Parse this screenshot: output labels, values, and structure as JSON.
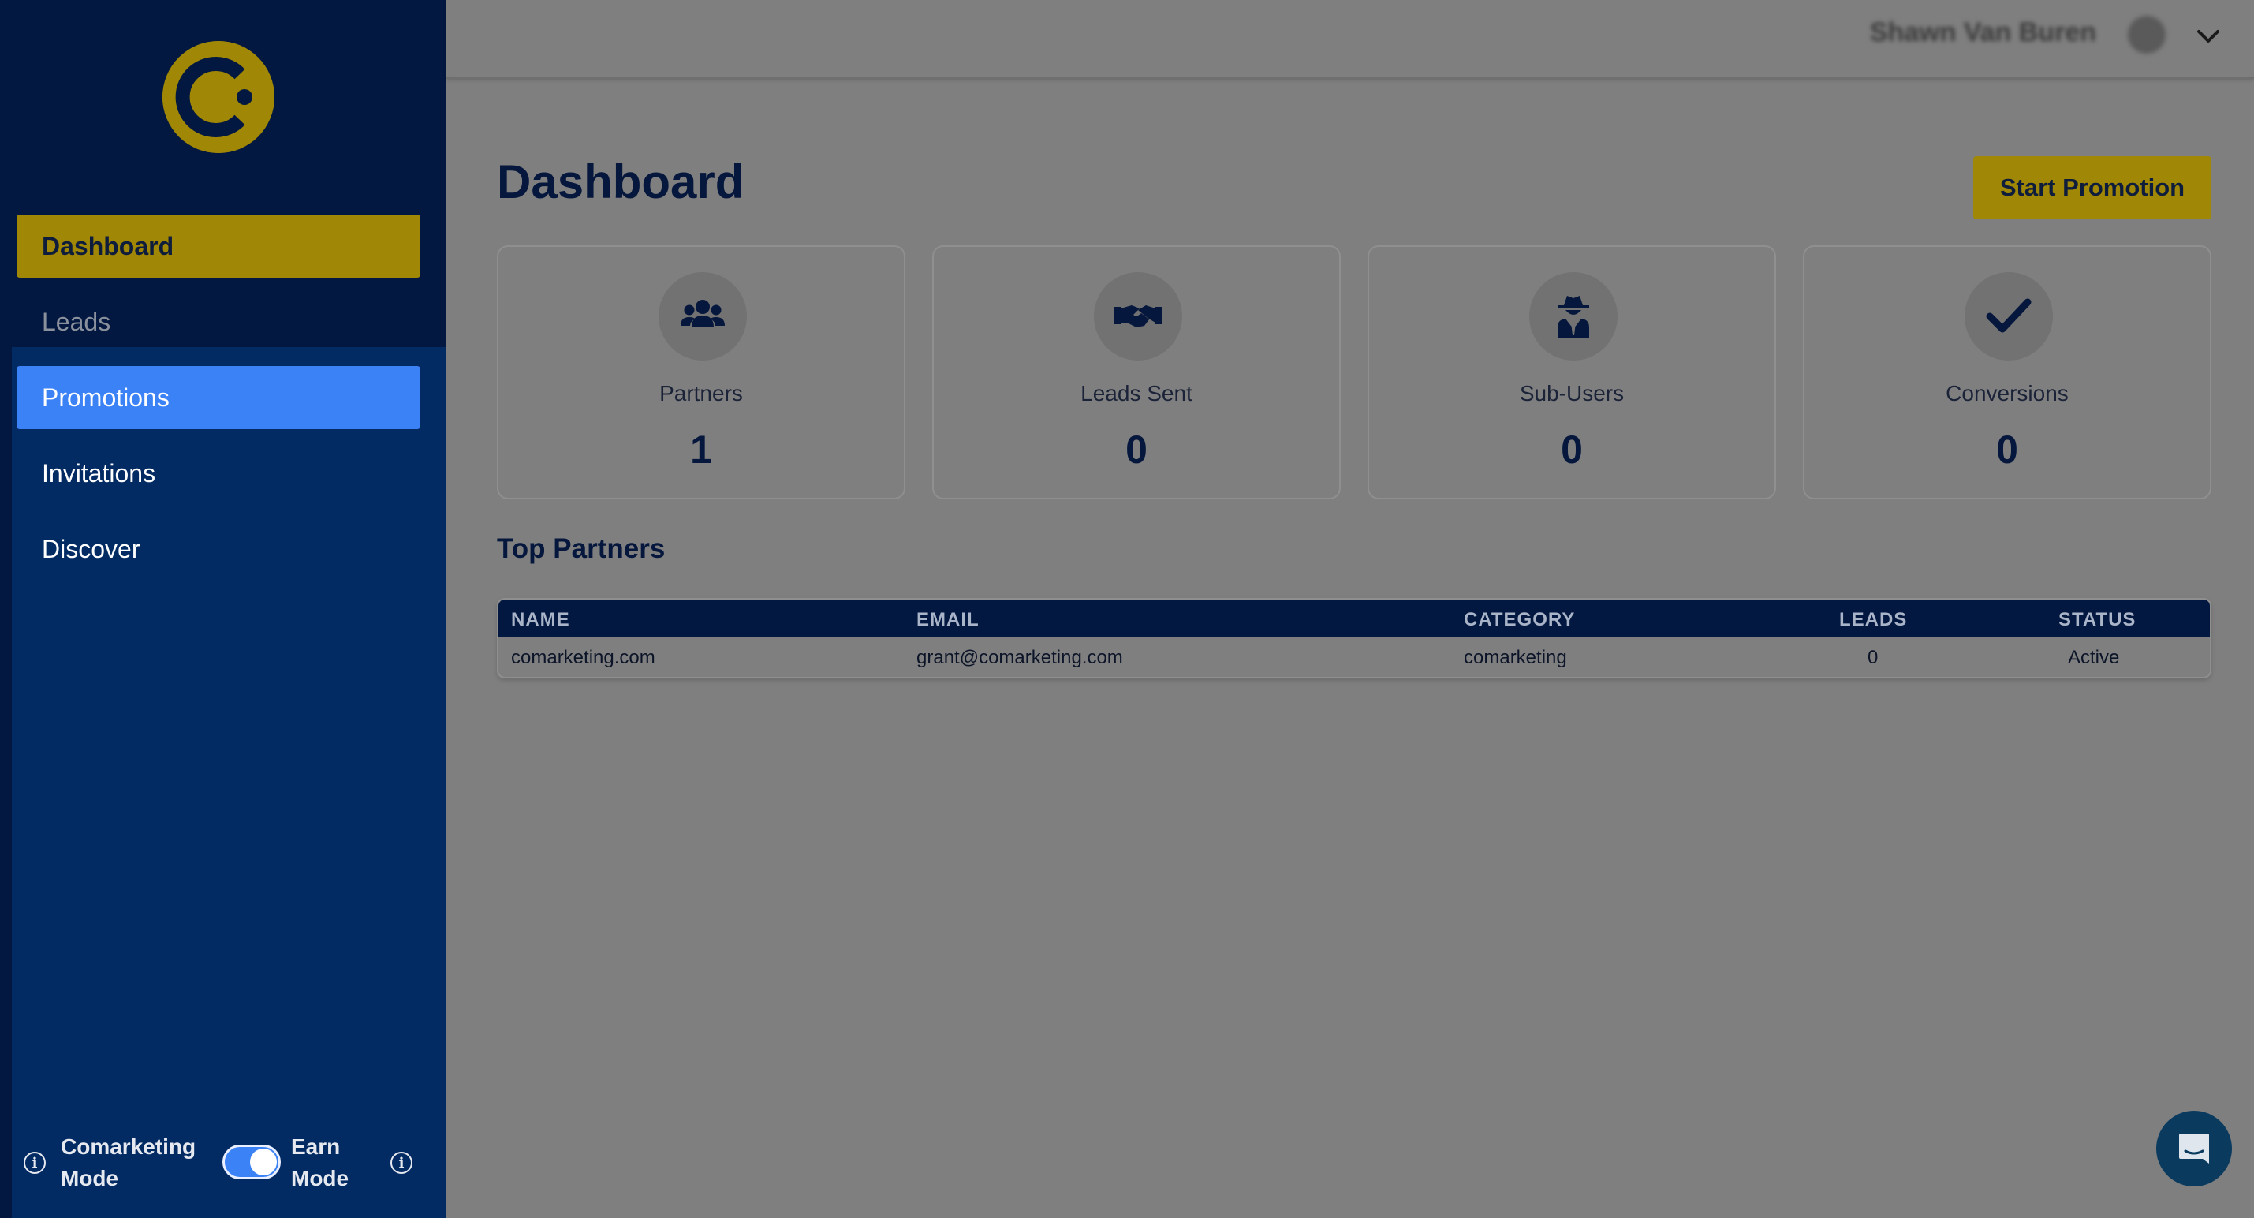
{
  "sidebar": {
    "logo_alt": "C",
    "items": [
      {
        "label": "Dashboard"
      },
      {
        "label": "Leads"
      },
      {
        "label": "Promotions"
      },
      {
        "label": "Invitations"
      },
      {
        "label": "Discover"
      }
    ],
    "mode_left_line1": "Comarketing",
    "mode_left_line2": "Mode",
    "mode_right_line1": "Earn",
    "mode_right_line2": "Mode",
    "toggle_on": true
  },
  "header": {
    "user_name": "Shawn Van Buren",
    "menu_icon": "chevron-down-icon"
  },
  "main": {
    "title": "Dashboard",
    "start_button": "Start Promotion",
    "stats": [
      {
        "label": "Partners",
        "value": "1",
        "icon": "users-icon"
      },
      {
        "label": "Leads Sent",
        "value": "0",
        "icon": "handshake-icon"
      },
      {
        "label": "Sub-Users",
        "value": "0",
        "icon": "user-secret-icon"
      },
      {
        "label": "Conversions",
        "value": "0",
        "icon": "check-icon"
      }
    ],
    "top_partners_title": "Top Partners",
    "table": {
      "headers": [
        "NAME",
        "EMAIL",
        "CATEGORY",
        "LEADS",
        "STATUS"
      ],
      "rows": [
        [
          "comarketing.com",
          "grant@comarketing.com",
          "comarketing",
          "0",
          "Active"
        ]
      ]
    }
  },
  "colors": {
    "sidebar_bg": "#021840",
    "sidebar_panel": "#022a63",
    "accent_gold": "#a08705",
    "active_blue": "#3b82f6",
    "title_navy": "#05173c"
  }
}
